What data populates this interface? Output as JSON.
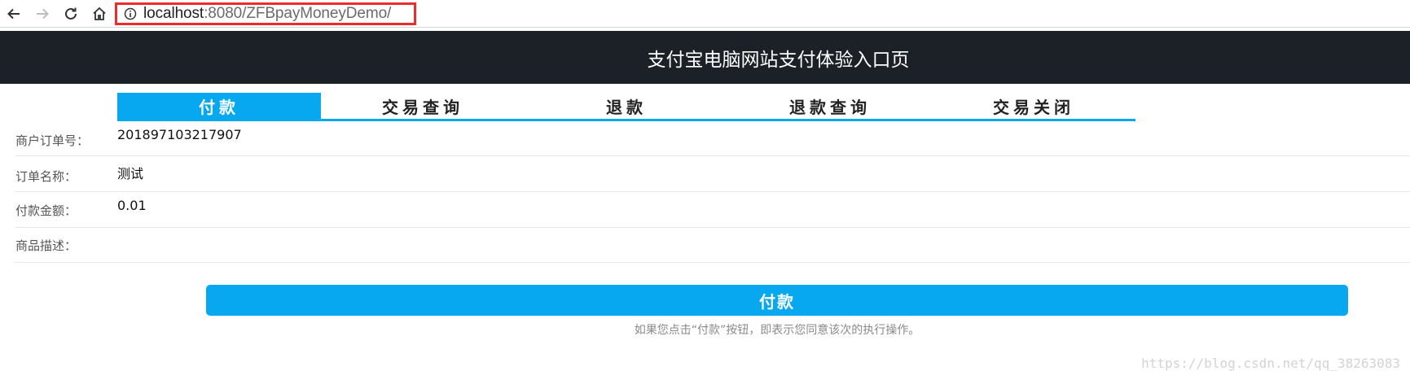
{
  "browser": {
    "nav_icons": [
      "back-arrow-icon",
      "forward-arrow-icon",
      "reload-icon",
      "home-icon",
      "info-icon"
    ],
    "url_host": "localhost",
    "url_rest": ":8080/ZFBpayMoneyDemo/",
    "highlight_color": "#ee2b2b"
  },
  "header": {
    "title": "支付宝电脑网站支付体验入口页",
    "background": "#1c2027"
  },
  "tabs": [
    {
      "label": "付款",
      "active": true
    },
    {
      "label": "交易查询",
      "active": false
    },
    {
      "label": "退款",
      "active": false
    },
    {
      "label": "退款查询",
      "active": false
    },
    {
      "label": "交易关闭",
      "active": false
    }
  ],
  "form": {
    "order_no": {
      "label": "商户订单号：",
      "value": "201897103217907"
    },
    "order_name": {
      "label": "订单名称：",
      "value": "测试"
    },
    "amount": {
      "label": "付款金额：",
      "value": "0.01"
    },
    "description": {
      "label": "商品描述：",
      "value": ""
    }
  },
  "submit": {
    "label": "付款",
    "notice": "如果您点击“付款”按钮，即表示您同意该次的执行操作。"
  },
  "accent_color": "#07a8ef",
  "watermark": "https://blog.csdn.net/qq_38263083"
}
